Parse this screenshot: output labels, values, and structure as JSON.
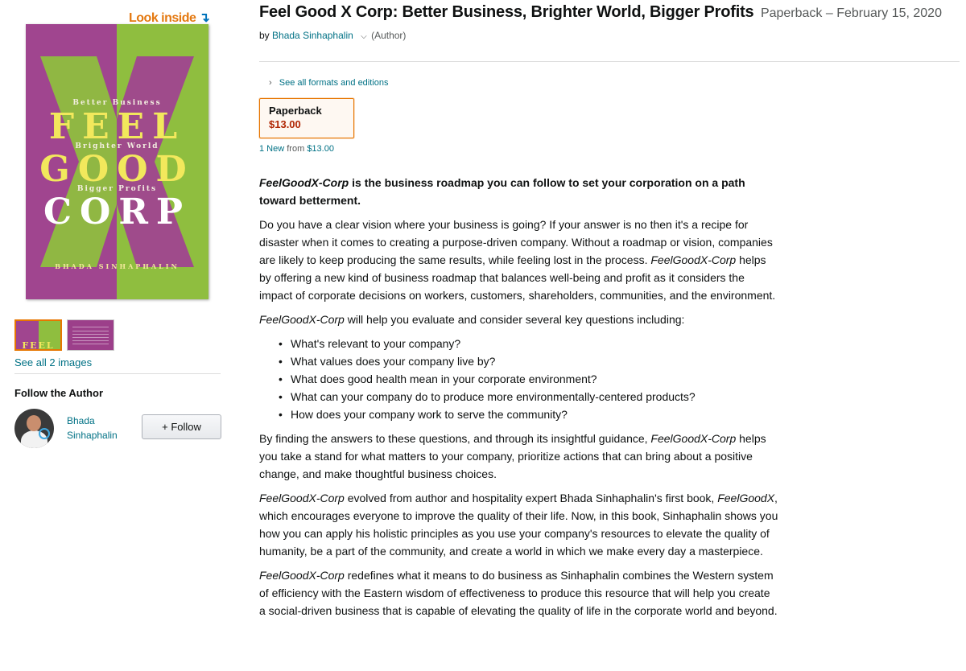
{
  "gallery": {
    "look_inside_label": "Look inside",
    "cover": {
      "tag_1": "Better Business",
      "word_1": "FEEL",
      "tag_2": "Brighter World",
      "word_2": "GOOD",
      "tag_3": "Bigger Profits",
      "word_3": "CORP",
      "author": "BHADA SINHAPHALIN",
      "colors": {
        "purple": "#a0458f",
        "green": "#8fbe3f",
        "yellow": "#f2e85c"
      }
    },
    "thumbnail_1_text": "FEEL",
    "see_all_images": "See all 2 images"
  },
  "follow": {
    "heading": "Follow the Author",
    "author_name": "Bhada Sinhaphalin",
    "follow_button": "+ Follow"
  },
  "product": {
    "title": "Feel Good X Corp: Better Business, Brighter World, Bigger Profits",
    "format_date": "Paperback – February 15, 2020",
    "by_label": "by",
    "author": "Bhada Sinhaphalin",
    "author_role": "(Author)",
    "see_all_formats": "See all formats and editions",
    "format": {
      "name": "Paperback",
      "price": "$13.00"
    },
    "new_from": {
      "count": "1 New",
      "from_label": "from",
      "price": "$13.00"
    }
  },
  "description": {
    "lead_italic": "FeelGoodX-Corp",
    "lead_rest": " is the business roadmap you can follow to set your corporation on a path toward betterment.",
    "p1_a": "Do you have a clear vision where your business is going? If your answer is no then it's a recipe for disaster when it comes to creating a purpose-driven company. Without a roadmap or vision, companies are likely to keep producing the same results, while feeling lost in the process. ",
    "p1_italic": "FeelGoodX-Corp",
    "p1_b": " helps by offering a new kind of business roadmap that balances well-being and profit as it considers the impact of corporate decisions on workers, customers, shareholders, communities, and the environment.",
    "p2_italic": "FeelGoodX-Corp",
    "p2_rest": " will help you evaluate and consider several key questions including:",
    "questions": [
      "What's relevant to your company?",
      "What values does your company live by?",
      "What does good health mean in your corporate environment?",
      "What can your company do to produce more environmentally-centered products?",
      "How does your company work to serve the community?"
    ],
    "p3_a": "By finding the answers to these questions, and through its insightful guidance, ",
    "p3_italic": "FeelGoodX-Corp",
    "p3_b": " helps you take a stand for what matters to your company, prioritize actions that can bring about a positive change, and make thoughtful business choices.",
    "p4_italic_1": "FeelGoodX-Corp",
    "p4_a": " evolved from author and hospitality expert Bhada Sinhaphalin's first book, ",
    "p4_italic_2": "FeelGoodX",
    "p4_b": ", which encourages everyone to improve the quality of their life. Now, in this book, Sinhaphalin shows you how you can apply his holistic principles as you use your company's resources to elevate the quality of humanity, be a part of the community, and create a world in which we make every day a masterpiece.",
    "p5_italic": "FeelGoodX-Corp",
    "p5_rest": " redefines what it means to do business as Sinhaphalin combines the Western system of efficiency with the Eastern wisdom of effectiveness to produce this resource that will help you create a social-driven business that is capable of elevating the quality of life in the corporate world and beyond."
  }
}
